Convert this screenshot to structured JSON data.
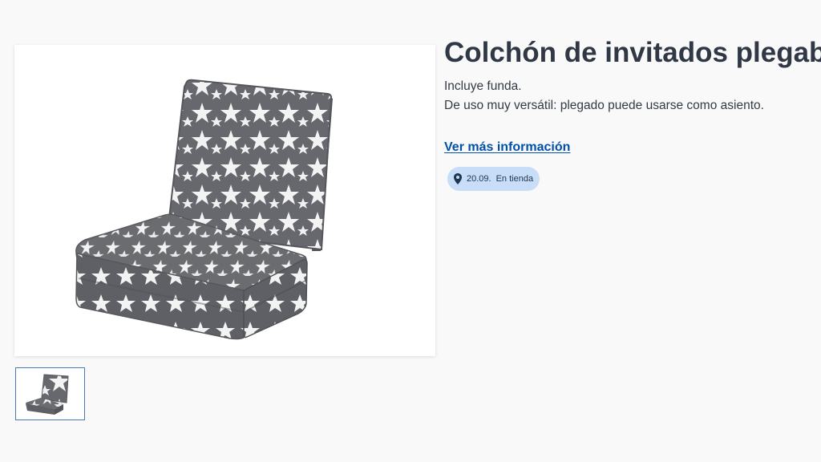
{
  "product": {
    "title": "Colchón de invitados plegable",
    "description_lines": [
      "Incluye funda.",
      "De uso muy versátil: plegado puede usarse como asiento."
    ],
    "more_info_link": "Ver más información",
    "availability": {
      "date": "20.09.",
      "location": "En tienda",
      "icon": "location-pin-icon"
    },
    "main_image": {
      "icon": "folding-mattress-image"
    },
    "thumbnail": {
      "icon": "folding-mattress-thumbnail"
    }
  },
  "colors": {
    "title": "#303846",
    "link": "#0050aa",
    "badge_background": "#c8def8",
    "mattress_fabric": "#67686d",
    "stars": "#ffffff"
  }
}
